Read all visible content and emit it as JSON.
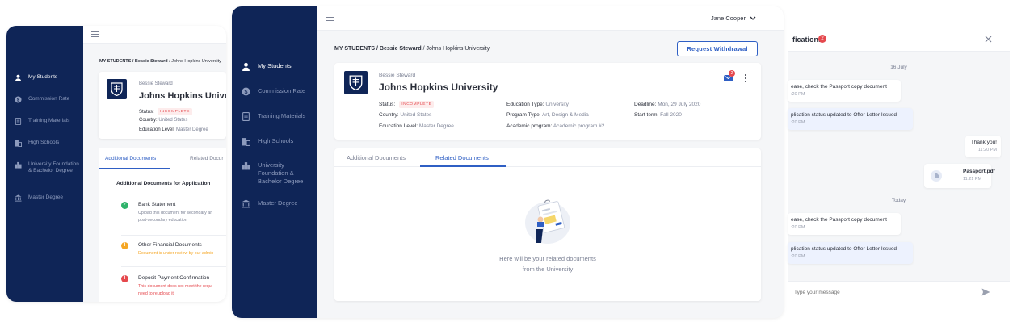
{
  "colors": {
    "sidebar": "#0f2557",
    "accent": "#2f5fc4",
    "danger": "#e5484d",
    "warning": "#f5a623",
    "success": "#2fb36b"
  },
  "nav": [
    {
      "label": "My Students",
      "icon": "person-icon"
    },
    {
      "label": "Commission Rate",
      "icon": "dollar-icon"
    },
    {
      "label": "Training Materials",
      "icon": "document-icon"
    },
    {
      "label": "High Schools",
      "icon": "building-icon"
    },
    {
      "label": "University Foundation & Bachelor Degree",
      "icon": "city-icon"
    },
    {
      "label": "Master Degree",
      "icon": "institution-icon"
    }
  ],
  "breadcrumb": {
    "root": "MY STUDENTS",
    "student": "Bessie Steward",
    "university": "Johns Hopkins University"
  },
  "user": {
    "name": "Jane Cooper"
  },
  "request_withdrawal_label": "Request Withdrawal",
  "application": {
    "student": "Bessie Steward",
    "university": "Johns Hopkins University",
    "status_label": "Status:",
    "status": "INCOMPLETE",
    "country_label": "Country:",
    "country": "United States",
    "education_level_label": "Education Level:",
    "education_level": "Master Degree",
    "education_type_label": "Education Type:",
    "education_type": "University",
    "program_type_label": "Program Type:",
    "program_type": "Art, Design & Media",
    "academic_program_label": "Academic program:",
    "academic_program": "Academic program #2",
    "deadline_label": "Deadline:",
    "deadline": "Mon, 29 July 2020",
    "start_term_label": "Start term:",
    "start_term": "Fall 2020",
    "mail_badge": "2"
  },
  "tabs": {
    "additional": "Additional Documents",
    "related": "Related Documents",
    "related_short": "Related Docur"
  },
  "additional_docs": {
    "heading": "Additional Documents for Application",
    "items": [
      {
        "title": "Bank Statement",
        "desc": "Upload this document for secondary an",
        "desc2": "post-secondary education",
        "state": "done"
      },
      {
        "title": "Other Financial Documents",
        "desc": "Document is under review by our admin",
        "desc2": "",
        "state": "review"
      },
      {
        "title": "Deposit Payment Confirmation",
        "desc": "This document does not meet the requi",
        "desc2": "need to reupload it.",
        "state": "rejected"
      }
    ]
  },
  "empty_state": {
    "line1": "Here will be your related documents",
    "line2": "from the University"
  },
  "notifications": {
    "title": "fications",
    "count": "2",
    "date1": "16 July",
    "date2": "Today",
    "messages": [
      {
        "text": "ease, check the Passport copy document",
        "time": ":20 PM"
      },
      {
        "text": "plication status updated to Offer Letter Issued",
        "time": ":20 PM"
      },
      {
        "text": "Thank you!",
        "time": "11:20 PM"
      },
      {
        "text": "Passport.pdf",
        "time": "11:21 PM"
      },
      {
        "text": "ease, check the Passport copy document",
        "time": ":20 PM"
      },
      {
        "text": "plication status updated to Offer Letter Issued",
        "time": ":20 PM"
      }
    ],
    "input_placeholder": "Type your message"
  }
}
